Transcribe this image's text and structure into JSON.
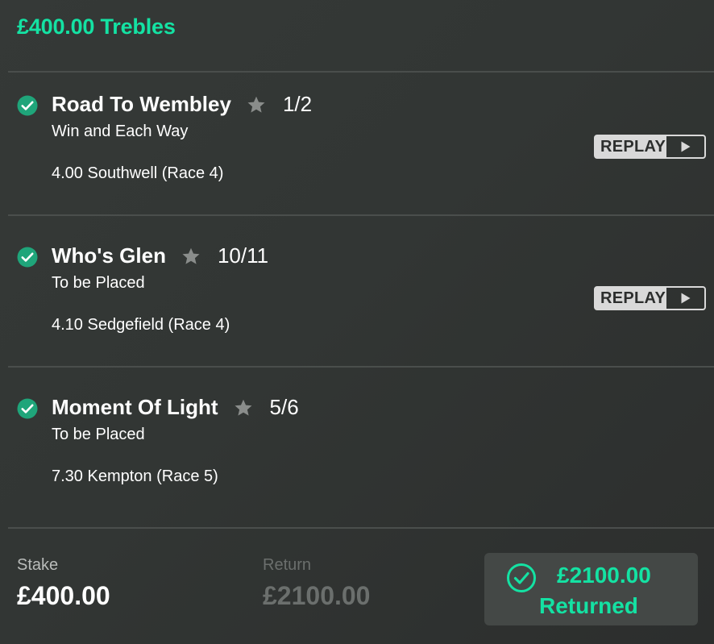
{
  "bet": {
    "title": "£400.00 Trebles"
  },
  "colors": {
    "accent": "#14e2a3",
    "check_circle": "#1fa57a",
    "star": "#8a8d8b",
    "replay_bg": "#d9d9d9",
    "muted_text": "#6b6f6d"
  },
  "selections": [
    {
      "name": "Road To Wembley",
      "odds": "1/2",
      "market": "Win and Each Way",
      "event": "4.00 Southwell (Race 4)",
      "status_icon": "check-circle-icon",
      "favourite_icon": "star-icon",
      "replay": {
        "label": "REPLAY",
        "icon": "play-icon"
      }
    },
    {
      "name": "Who's Glen",
      "odds": "10/11",
      "market": "To be Placed",
      "event": "4.10 Sedgefield (Race 4)",
      "status_icon": "check-circle-icon",
      "favourite_icon": "star-icon",
      "replay": {
        "label": "REPLAY",
        "icon": "play-icon"
      }
    },
    {
      "name": "Moment Of Light",
      "odds": "5/6",
      "market": "To be Placed",
      "event": "7.30 Kempton (Race 5)",
      "status_icon": "check-circle-icon",
      "favourite_icon": "star-icon"
    }
  ],
  "footer": {
    "stake_label": "Stake",
    "stake_value": "£400.00",
    "return_label": "Return",
    "return_value": "£2100.00",
    "returned_amount": "£2100.00",
    "returned_label": "Returned",
    "returned_icon": "check-circle-outline-icon"
  }
}
